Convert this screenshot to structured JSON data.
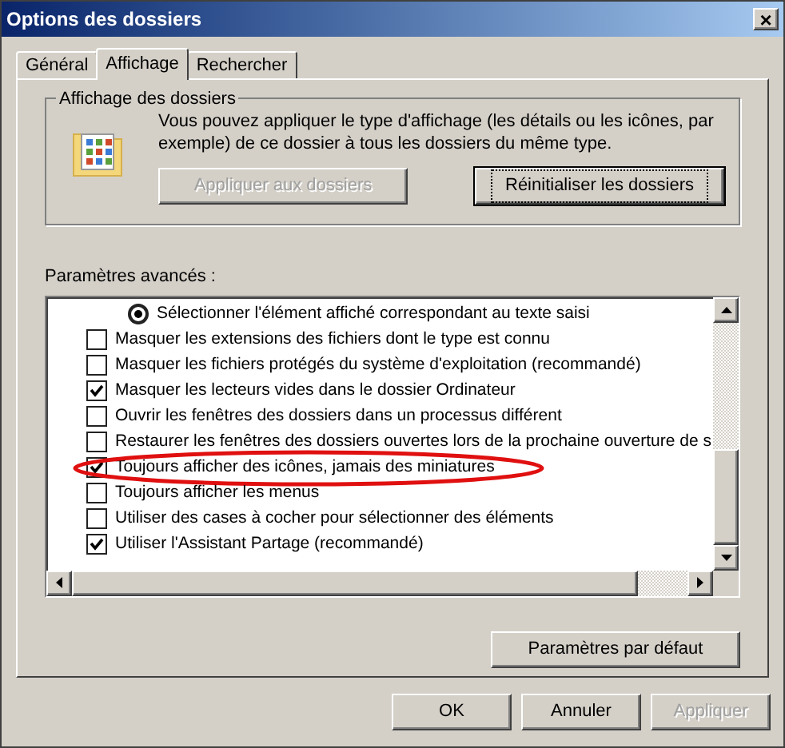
{
  "window": {
    "title": "Options des dossiers",
    "close": "×"
  },
  "tabs": [
    {
      "label": "Général",
      "selected": false
    },
    {
      "label": "Affichage",
      "selected": true
    },
    {
      "label": "Rechercher",
      "selected": false
    }
  ],
  "folder_views": {
    "title": "Affichage des dossiers",
    "description": "Vous pouvez appliquer le type d'affichage (les détails ou les icônes, par exemple) de ce dossier à tous les dossiers du même type.",
    "buttons": [
      {
        "label": "Appliquer aux dossiers",
        "disabled": true,
        "focused": false
      },
      {
        "label": "Réinitialiser les dossiers",
        "disabled": false,
        "focused": true
      }
    ]
  },
  "advanced": {
    "title": "Paramètres avancés :",
    "items": [
      {
        "kind": "radio",
        "label": "Sélectionner l'élément affiché correspondant au texte saisi",
        "checked": true
      },
      {
        "kind": "checkbox",
        "label": "Masquer les extensions des fichiers dont le type est connu",
        "checked": false
      },
      {
        "kind": "checkbox",
        "label": "Masquer les fichiers protégés du système d'exploitation (recommandé)",
        "checked": false
      },
      {
        "kind": "checkbox",
        "label": "Masquer les lecteurs vides dans le dossier Ordinateur",
        "checked": true
      },
      {
        "kind": "checkbox",
        "label": "Ouvrir les fenêtres des dossiers dans un processus différent",
        "checked": false
      },
      {
        "kind": "checkbox",
        "label": "Restaurer les fenêtres des dossiers ouvertes lors de la prochaine ouverture de s",
        "checked": false
      },
      {
        "kind": "checkbox",
        "label": "Toujours afficher des icônes, jamais des miniatures",
        "checked": true,
        "circled": true
      },
      {
        "kind": "checkbox",
        "label": "Toujours afficher les menus",
        "checked": false
      },
      {
        "kind": "checkbox",
        "label": "Utiliser des cases à cocher pour sélectionner des éléments",
        "checked": false
      },
      {
        "kind": "checkbox",
        "label": "Utiliser l'Assistant Partage (recommandé)",
        "checked": true
      }
    ],
    "defaults_button": "Paramètres par défaut"
  },
  "buttons": [
    {
      "label": "OK",
      "disabled": false
    },
    {
      "label": "Annuler",
      "disabled": false
    },
    {
      "label": "Appliquer",
      "disabled": true
    }
  ]
}
